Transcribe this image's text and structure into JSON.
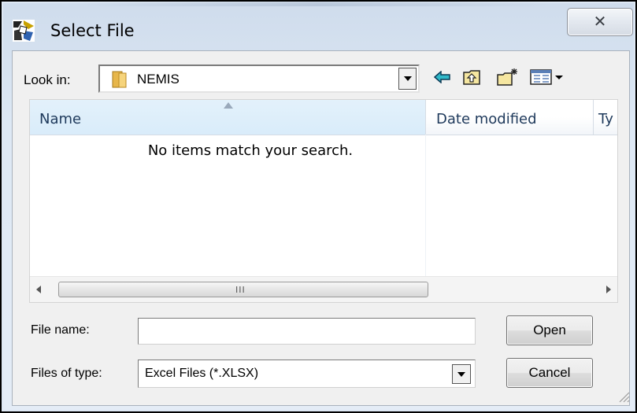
{
  "window": {
    "title": "Select File",
    "close_glyph": "✕",
    "icon": "app-icon"
  },
  "lookin": {
    "label": "Look in:",
    "value": "NEMIS",
    "icon": "folder-icon"
  },
  "toolbar": {
    "back_icon": "back-arrow-icon",
    "up_icon": "up-folder-icon",
    "new_folder_icon": "new-folder-icon",
    "view_menu_icon": "view-menu-icon"
  },
  "file_list": {
    "columns": [
      "Name",
      "Date modified",
      "Ty"
    ],
    "empty_message": "No items match your search.",
    "scroll_grip": "III"
  },
  "file_name": {
    "label": "File name:",
    "value": "",
    "placeholder": ""
  },
  "file_type": {
    "label": "Files of type:",
    "value": "Excel Files (*.XLSX)"
  },
  "buttons": {
    "open": "Open",
    "cancel": "Cancel"
  }
}
